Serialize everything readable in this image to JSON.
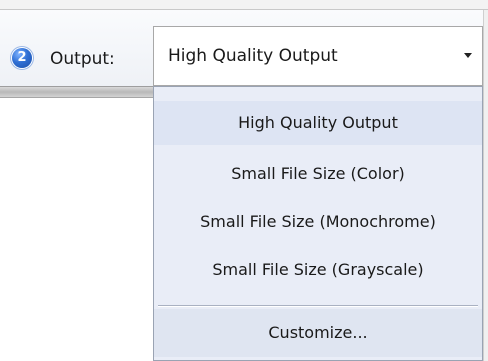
{
  "step": {
    "number": "2"
  },
  "output": {
    "label": "Output:",
    "selected_value": "High Quality Output",
    "options": [
      "High Quality Output",
      "Small File Size (Color)",
      "Small File Size (Monochrome)",
      "Small File Size (Grayscale)"
    ],
    "customize_label": "Customize..."
  }
}
